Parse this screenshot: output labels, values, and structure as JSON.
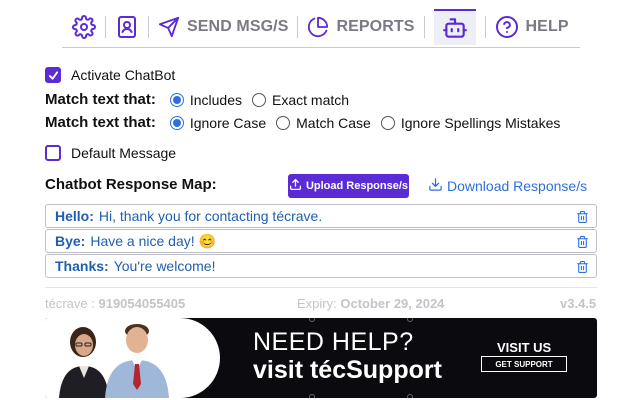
{
  "nav": {
    "items": [
      {
        "icon": "gear-icon",
        "label": ""
      },
      {
        "icon": "contacts-icon",
        "label": ""
      },
      {
        "icon": "send-icon",
        "label": "SEND MSG/S"
      },
      {
        "icon": "reports-icon",
        "label": "REPORTS"
      },
      {
        "icon": "chatbot-icon",
        "label": ""
      },
      {
        "icon": "help-icon",
        "label": "HELP"
      }
    ],
    "active": "chatbot"
  },
  "settings": {
    "activate_label": "Activate ChatBot",
    "activate_checked": true,
    "match_type": {
      "label": "Match text that:",
      "options": [
        "Includes",
        "Exact match"
      ],
      "selected": "Includes"
    },
    "match_case": {
      "label": "Match text that:",
      "options": [
        "Ignore Case",
        "Match Case",
        "Ignore Spellings Mistakes"
      ],
      "selected": "Ignore Case"
    },
    "default_label": "Default Message",
    "default_checked": false
  },
  "response_map": {
    "title": "Chatbot Response Map:",
    "upload_label": "Upload Response/s",
    "download_label": "Download Response/s",
    "items": [
      {
        "key": "Hello:",
        "value": "Hi, thank you for contacting técrave."
      },
      {
        "key": "Bye:",
        "value": "Have a nice day! 😊"
      },
      {
        "key": "Thanks:",
        "value": "You're welcome!"
      }
    ]
  },
  "footer": {
    "account_label": "técrave :",
    "account_number": "919054055405",
    "expiry_label": "Expiry:",
    "expiry_date": "October 29, 2024",
    "version": "v3.4.5"
  },
  "banner": {
    "line1": "NEED HELP?",
    "line2": "visit técSupport",
    "cta_title": "VISIT US",
    "cta_button": "GET SUPPORT"
  },
  "colors": {
    "accent": "#5b2bd6",
    "link": "#2f6fdc",
    "muted": "#7a7a86"
  }
}
